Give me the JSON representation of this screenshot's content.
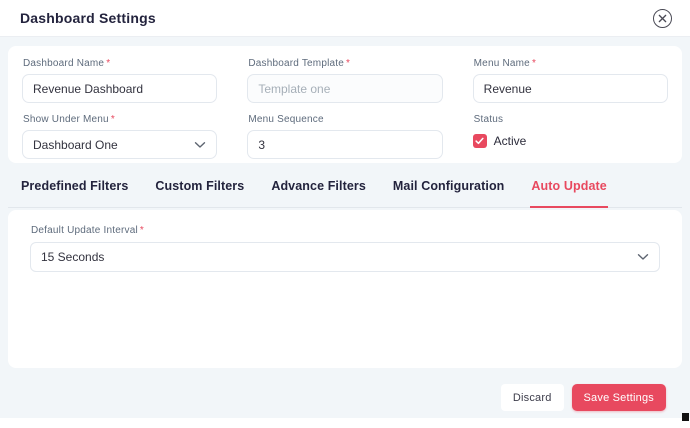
{
  "header": {
    "title": "Dashboard Settings"
  },
  "required_marker": "*",
  "form": {
    "fields": [
      {
        "label": "Dashboard Name",
        "required": true,
        "type": "text",
        "value": "Revenue Dashboard"
      },
      {
        "label": "Dashboard Template",
        "required": true,
        "type": "text",
        "value": "",
        "placeholder": "Template one"
      },
      {
        "label": "Menu Name",
        "required": true,
        "type": "text",
        "value": "Revenue"
      },
      {
        "label": "Show Under Menu",
        "required": true,
        "type": "select",
        "value": "Dashboard One"
      },
      {
        "label": "Menu Sequence",
        "required": false,
        "type": "text",
        "value": "3"
      },
      {
        "label": "Status",
        "required": false,
        "type": "checkbox",
        "checkbox_label": "Active",
        "checked": true
      }
    ]
  },
  "tabs": {
    "items": [
      {
        "label": "Predefined Filters",
        "active": false
      },
      {
        "label": "Custom Filters",
        "active": false
      },
      {
        "label": "Advance Filters",
        "active": false
      },
      {
        "label": "Mail Configuration",
        "active": false
      },
      {
        "label": "Auto Update",
        "active": true
      }
    ]
  },
  "panel": {
    "label": "Default Update Interval",
    "required": true,
    "value": "15 Seconds"
  },
  "footer": {
    "discard_label": "Discard",
    "save_label": "Save Settings"
  },
  "colors": {
    "accent": "#e8495f",
    "page_background": "#f2f6f9",
    "card_background": "#ffffff"
  }
}
